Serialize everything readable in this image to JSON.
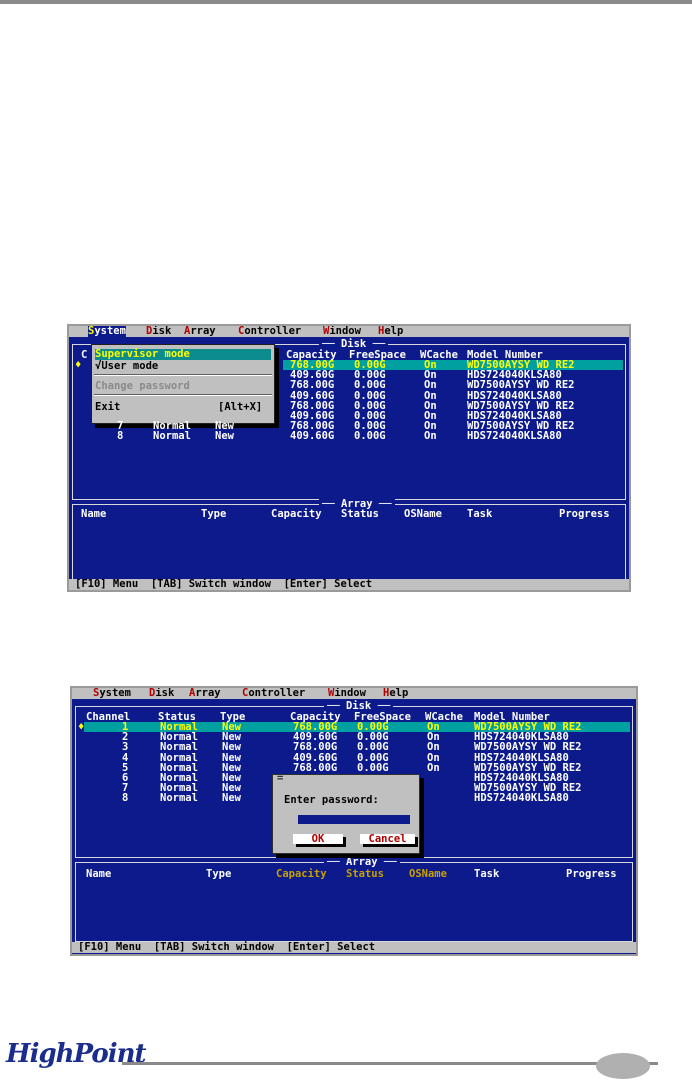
{
  "menubar": {
    "system": "System",
    "disk": "Disk",
    "array": "Array",
    "controller": "Controller",
    "window": "Window",
    "help": "Help"
  },
  "disk_window": {
    "title": "Disk",
    "columns": [
      "Channel",
      "Status",
      "Type",
      "Capacity",
      "FreeSpace",
      "WCache",
      "Model Number"
    ],
    "rows": [
      {
        "channel": "1",
        "status": "Normal",
        "type": "New",
        "capacity": "768.00G",
        "free": "0.00G",
        "wcache": "On",
        "model": "WD7500AYSY WD RE2"
      },
      {
        "channel": "2",
        "status": "Normal",
        "type": "New",
        "capacity": "409.60G",
        "free": "0.00G",
        "wcache": "On",
        "model": "HDS724040KLSA80"
      },
      {
        "channel": "3",
        "status": "Normal",
        "type": "New",
        "capacity": "768.00G",
        "free": "0.00G",
        "wcache": "On",
        "model": "WD7500AYSY WD RE2"
      },
      {
        "channel": "4",
        "status": "Normal",
        "type": "New",
        "capacity": "409.60G",
        "free": "0.00G",
        "wcache": "On",
        "model": "HDS724040KLSA80"
      },
      {
        "channel": "5",
        "status": "Normal",
        "type": "New",
        "capacity": "768.00G",
        "free": "0.00G",
        "wcache": "On",
        "model": "WD7500AYSY WD RE2"
      },
      {
        "channel": "6",
        "status": "Normal",
        "type": "New",
        "capacity": "409.60G",
        "free": "0.00G",
        "wcache": "On",
        "model": "HDS724040KLSA80"
      },
      {
        "channel": "7",
        "status": "Normal",
        "type": "New",
        "capacity": "768.00G",
        "free": "0.00G",
        "wcache": "On",
        "model": "WD7500AYSY WD RE2"
      },
      {
        "channel": "8",
        "status": "Normal",
        "type": "New",
        "capacity": "409.60G",
        "free": "0.00G",
        "wcache": "On",
        "model": "HDS724040KLSA80"
      }
    ],
    "selected_marker": "♦"
  },
  "array_window": {
    "title": "Array",
    "columns": [
      "Name",
      "Type",
      "Capacity",
      "Status",
      "OSName",
      "Task",
      "Progress"
    ]
  },
  "status_bar": "[F10] Menu  [TAB] Switch window  [Enter] Select",
  "system_menu": {
    "supervisor": "Supervisor mode",
    "user": "√User mode",
    "change_password": "Change password",
    "exit": "Exit",
    "exit_shortcut": "[Alt+X]"
  },
  "password_dialog": {
    "prompt": "Enter password:",
    "ok": "OK",
    "cancel": "Cancel"
  },
  "footer": {
    "logo": "HighPoint"
  },
  "colors": {
    "screen_background": "#0c1a8c",
    "menubar": "#c0c0c0",
    "highlight_row": "#00a0a0",
    "highlight_text": "#ffff00"
  }
}
